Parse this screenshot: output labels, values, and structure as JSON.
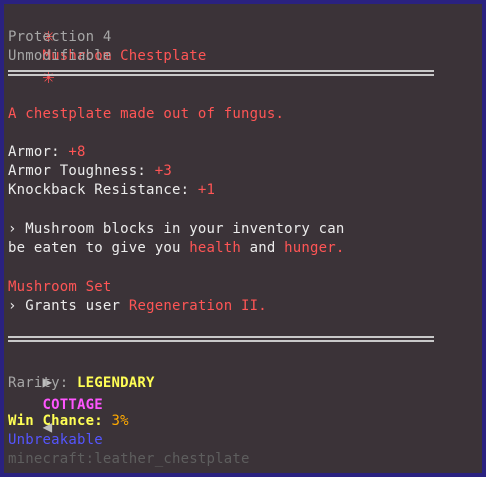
{
  "title": {
    "star_left": "✳",
    "name": "Mushroom Chestplate",
    "star_right": "✳"
  },
  "enchant_line": "Protection 4",
  "modifiable_line": "Unmodifiable",
  "description": "A chestplate made out of fungus.",
  "stats": [
    {
      "label": "Armor: ",
      "value": "+8"
    },
    {
      "label": "Armor Toughness: ",
      "value": "+3"
    },
    {
      "label": "Knockback Resistance: ",
      "value": "+1"
    }
  ],
  "ability": {
    "line1": "› Mushroom blocks in your inventory can",
    "line2_prefix": "be eaten to give you ",
    "line2_health": "health",
    "line2_and": " and ",
    "line2_hunger": "hunger",
    "line2_end": "."
  },
  "set_bonus": {
    "name_a": "Mushroom ",
    "name_b": "Set",
    "grants_prefix": "› Grants user ",
    "grants_effect": "Regeneration II",
    "grants_end": "."
  },
  "collection": {
    "arrow_left": "▶",
    "name": "COTTAGE",
    "arrow_right": "◀"
  },
  "rarity": {
    "label": "Rarity: ",
    "value": "LEGENDARY"
  },
  "win_chance": {
    "label": "Win Chance: ",
    "value": "3%"
  },
  "unbreakable": "Unbreakable",
  "item_id": "minecraft:leather_chestplate",
  "colors": {
    "background": "#3b3338",
    "border": "#2a2280",
    "red": "#ff5555",
    "gold": "#ffaa00",
    "yellow": "#ffff55",
    "pink": "#ff55ff",
    "blue": "#5555ff",
    "gray": "#a6a6a6"
  }
}
